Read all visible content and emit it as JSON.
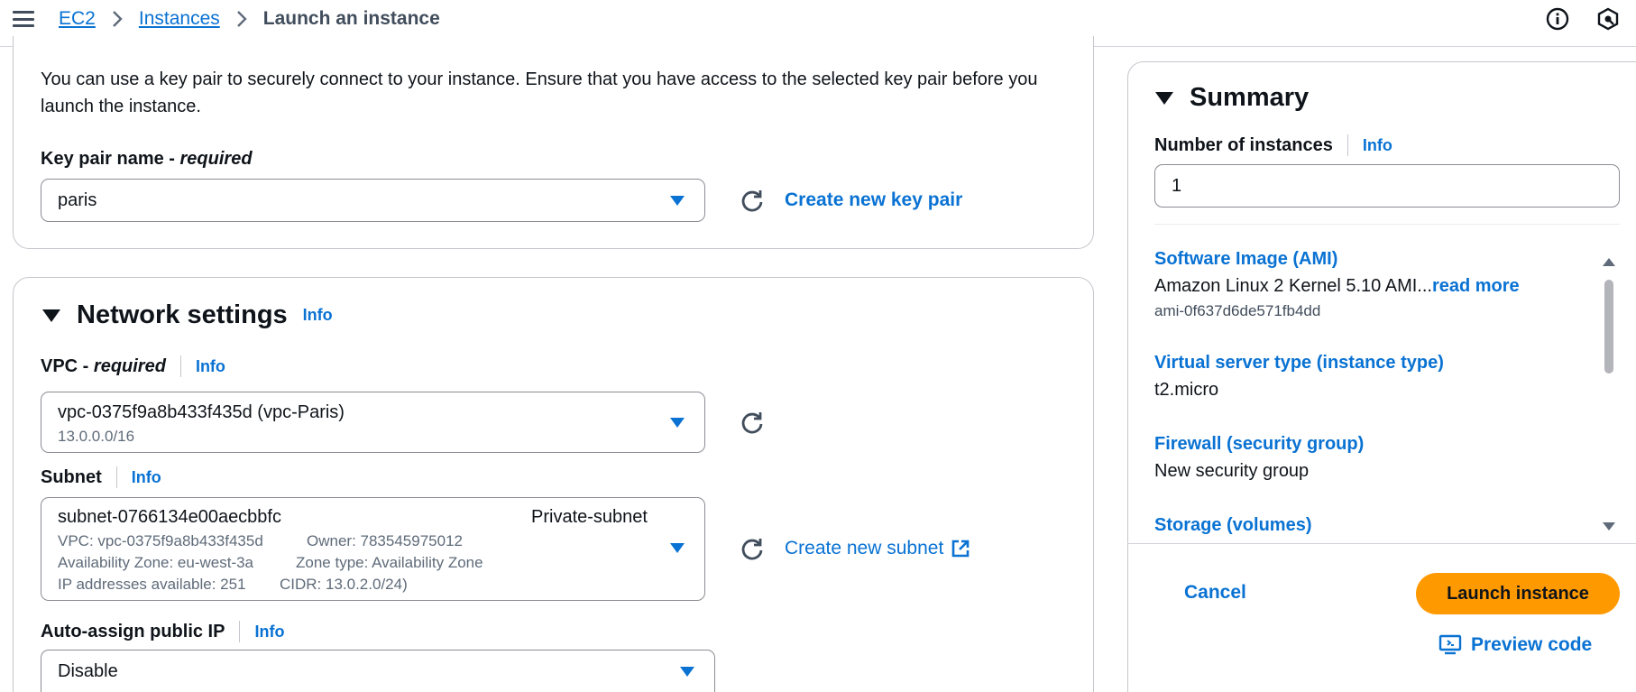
{
  "breadcrumb": {
    "items": [
      "EC2",
      "Instances"
    ],
    "current": "Launch an instance"
  },
  "key_pair": {
    "description": "You can use a key pair to securely connect to your instance. Ensure that you have access to the selected key pair before you launch the instance.",
    "label": "Key pair name - ",
    "label_required": "required",
    "value": "paris",
    "create_link": "Create new key pair"
  },
  "network": {
    "title": "Network settings",
    "info": "Info",
    "vpc": {
      "label": "VPC - ",
      "label_required": "required",
      "info": "Info",
      "value": "vpc-0375f9a8b433f435d (vpc-Paris)",
      "cidr": "13.0.0.0/16"
    },
    "subnet": {
      "label": "Subnet",
      "info": "Info",
      "value": "subnet-0766134e00aecbbfc",
      "name": "Private-subnet",
      "vpc": "VPC: vpc-0375f9a8b433f435d",
      "owner": "Owner: 783545975012",
      "az": "Availability Zone: eu-west-3a",
      "zone_type": "Zone type: Availability Zone",
      "ips": "IP addresses available: 251",
      "cidr": "CIDR: 13.0.2.0/24)",
      "create_link": "Create new subnet"
    },
    "public_ip": {
      "label": "Auto-assign public IP",
      "info": "Info",
      "value": "Disable"
    }
  },
  "summary": {
    "title": "Summary",
    "num_instances_label": "Number of instances",
    "info": "Info",
    "num_instances": "1",
    "ami_label": "Software Image (AMI)",
    "ami_value": "Amazon Linux 2 Kernel 5.10 AMI...",
    "ami_read_more": "read more",
    "ami_id": "ami-0f637d6de571fb4dd",
    "type_label": "Virtual server type (instance type)",
    "type_value": "t2.micro",
    "firewall_label": "Firewall (security group)",
    "firewall_value": "New security group",
    "storage_label": "Storage (volumes)",
    "cancel": "Cancel",
    "launch": "Launch instance",
    "preview": "Preview code"
  },
  "colors": {
    "link": "#0972d3",
    "primary_button": "#ff9900",
    "text": "#0f141a"
  },
  "icons": [
    "menu-icon",
    "chevron-right-icon",
    "info-circle-icon",
    "notification-icon",
    "refresh-icon",
    "external-link-icon",
    "caret-down-icon",
    "preview-code-icon"
  ]
}
